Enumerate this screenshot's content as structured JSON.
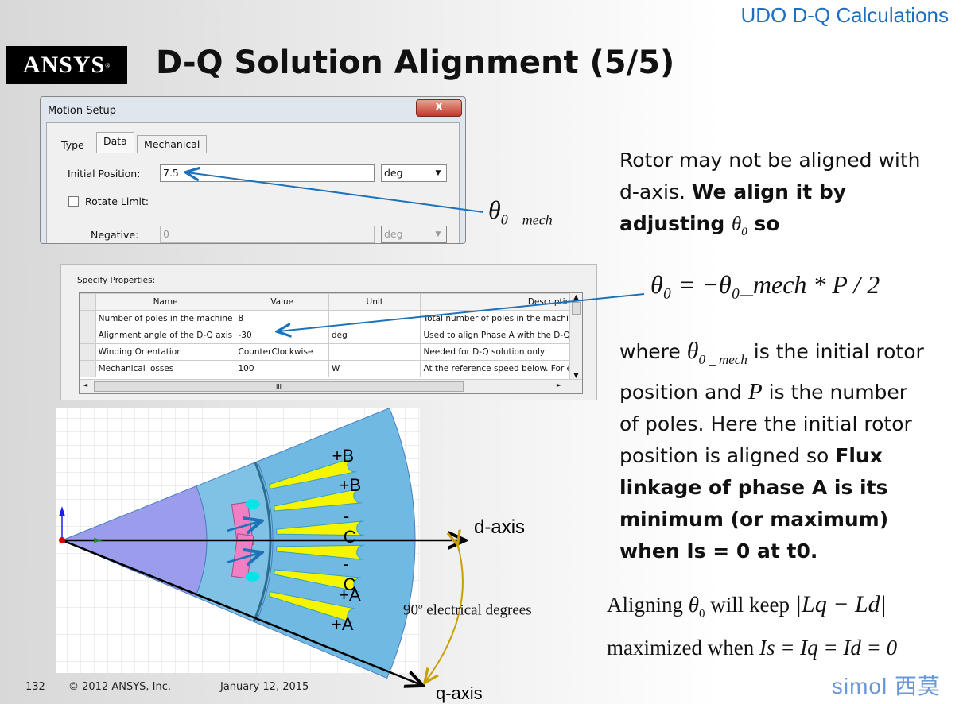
{
  "header": {
    "section": "UDO D-Q Calculations",
    "logo": "ANSYS",
    "title": "D-Q Solution Alignment (5/5)"
  },
  "motion_setup": {
    "title": "Motion Setup",
    "close": "X",
    "tabs": [
      {
        "label": "Type"
      },
      {
        "label": "Data",
        "active": true
      },
      {
        "label": "Mechanical"
      }
    ],
    "initial_position_label": "Initial Position:",
    "initial_position_value": "7.5",
    "initial_position_unit": "deg",
    "rotate_limit_label": "Rotate Limit:",
    "rotate_limit_checked": false,
    "negative_label": "Negative:",
    "negative_value": "0",
    "negative_unit": "deg"
  },
  "properties": {
    "caption": "Specify Properties:",
    "columns": [
      "Name",
      "Value",
      "Unit",
      "Descriptio"
    ],
    "rows": [
      [
        "Number of poles in the machine",
        "8",
        "",
        "Total number of poles in the machine"
      ],
      [
        "Alignment angle of the D-Q axis",
        "-30",
        "deg",
        "Used to align Phase A with the D-Q a"
      ],
      [
        "Winding Orientation",
        "CounterClockwise",
        "",
        "Needed for D-Q solution only"
      ],
      [
        "Mechanical losses",
        "100",
        "W",
        "At the reference speed below. For e"
      ]
    ]
  },
  "diagram": {
    "slot_labels": [
      "+B",
      "+B",
      "-C",
      "-C",
      "+A",
      "+A"
    ],
    "d_axis": "d-axis",
    "q_axis": "q-axis",
    "angle_label_num": "90",
    "angle_label_sup": "o",
    "angle_label_text": " electrical degrees",
    "theta_mech_label": "θ",
    "theta_mech_sub": "0 _ mech",
    "colors": {
      "rotor": "#9b9cec",
      "stator": "#6fb9e3",
      "airgap": "#7fc2e6",
      "coil": "#f5f500",
      "magnet": "#f07fc3",
      "arrow": "#1f72b8",
      "arc": "#c8a000"
    }
  },
  "right_text": {
    "p1_a": "Rotor may not be aligned with d-axis. ",
    "p1_b": "We align it by adjusting ",
    "p1_c": " so",
    "eq": "θ₀ = −θ₀_mech * P / 2",
    "p2_a": "where ",
    "p2_b": " is the initial rotor position and ",
    "p2_P": "P",
    "p2_c": " is the number of poles. Here the initial rotor position is aligned so ",
    "p2_bold": "Flux linkage of phase A is its minimum (or maximum) when Is = 0 at t0.",
    "p3_a": "Aligning ",
    "p3_b": " will keep ",
    "p3_abs": "|Lq − Ld|",
    "p4_a": "maximized when ",
    "p4_eq": "Is = Iq = Id = 0"
  },
  "footer": {
    "page": "132",
    "copyright": "© 2012 ANSYS, Inc.",
    "date": "January 12, 2015",
    "watermark": "simol 西莫"
  }
}
